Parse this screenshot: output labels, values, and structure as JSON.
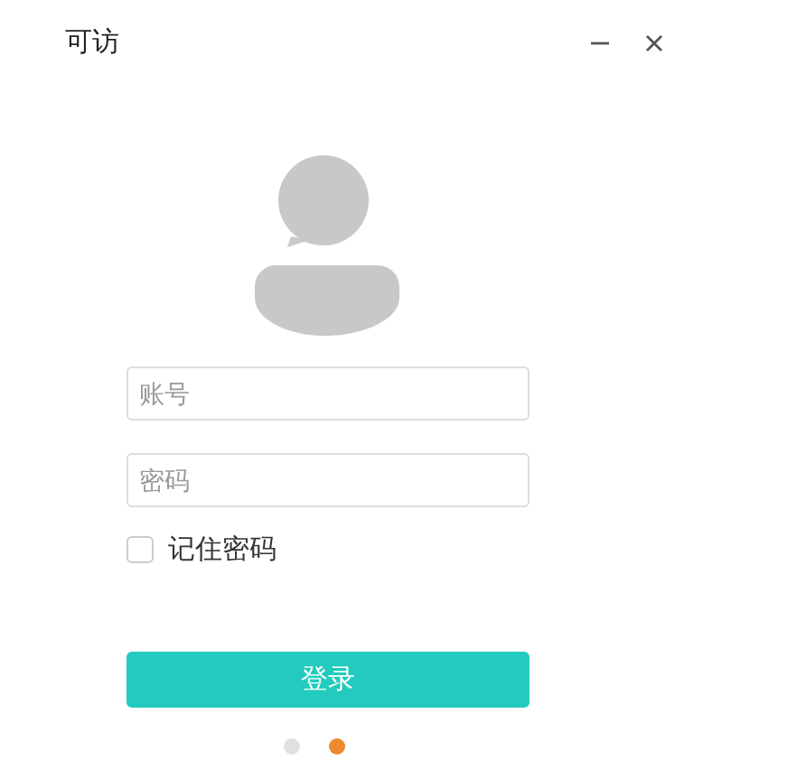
{
  "window": {
    "title": "可访"
  },
  "account": {
    "placeholder": "账号"
  },
  "password": {
    "placeholder": "密码"
  },
  "remember": {
    "label": "记住密码",
    "checked": false
  },
  "login_button": {
    "label": "登录"
  },
  "pager": [
    {
      "selected": false
    },
    {
      "selected": true
    }
  ]
}
